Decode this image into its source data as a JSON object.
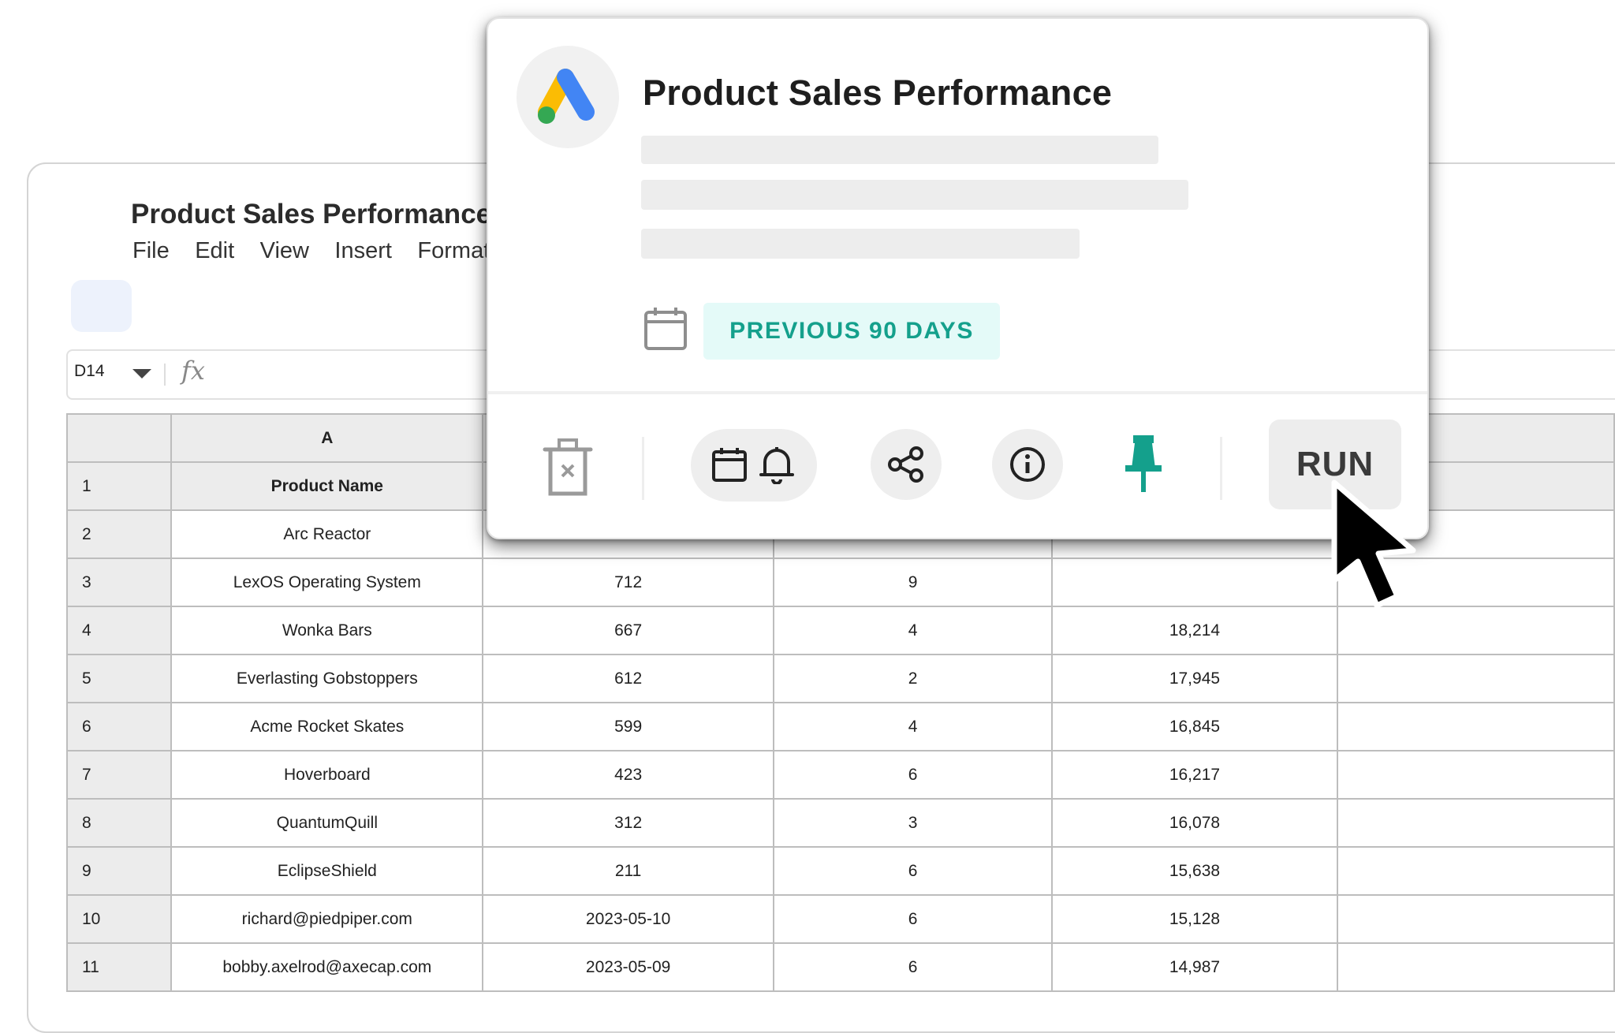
{
  "spreadsheet": {
    "title": "Product Sales Performance",
    "menu": [
      "File",
      "Edit",
      "View",
      "Insert",
      "Format"
    ],
    "namebox": "D14",
    "formula_icon": "fx",
    "column_letters": [
      "",
      "A",
      "",
      "",
      "",
      ""
    ],
    "rows": [
      {
        "num": "1",
        "cells": [
          "Product Name",
          "",
          "",
          "",
          ""
        ]
      },
      {
        "num": "2",
        "cells": [
          "Arc Reactor",
          "",
          "",
          "",
          ""
        ]
      },
      {
        "num": "3",
        "cells": [
          "LexOS Operating System",
          "712",
          "9",
          "",
          ""
        ]
      },
      {
        "num": "4",
        "cells": [
          "Wonka Bars",
          "667",
          "4",
          "18,214",
          ""
        ]
      },
      {
        "num": "5",
        "cells": [
          "Everlasting Gobstoppers",
          "612",
          "2",
          "17,945",
          ""
        ]
      },
      {
        "num": "6",
        "cells": [
          "Acme Rocket Skates",
          "599",
          "4",
          "16,845",
          ""
        ]
      },
      {
        "num": "7",
        "cells": [
          "Hoverboard",
          "423",
          "6",
          "16,217",
          ""
        ]
      },
      {
        "num": "8",
        "cells": [
          "QuantumQuill",
          "312",
          "3",
          "16,078",
          ""
        ]
      },
      {
        "num": "9",
        "cells": [
          "EclipseShield",
          "211",
          "6",
          "15,638",
          ""
        ]
      },
      {
        "num": "10",
        "cells": [
          "richard@piedpiper.com",
          "2023-05-10",
          "6",
          "15,128",
          ""
        ]
      },
      {
        "num": "11",
        "cells": [
          "bobby.axelrod@axecap.com",
          "2023-05-09",
          "6",
          "14,987",
          ""
        ]
      }
    ]
  },
  "popup": {
    "logo_icon": "google-ads-logo-icon",
    "title": "Product Sales Performance",
    "date_range_icon": "calendar-icon",
    "date_range": "PREVIOUS 90 DAYS",
    "actions": {
      "delete_icon": "trash-icon",
      "schedule_icons": [
        "calendar-icon",
        "bell-icon"
      ],
      "share_icon": "share-icon",
      "info_icon": "info-icon",
      "pin_icon": "pin-icon",
      "run_label": "RUN"
    },
    "colors": {
      "badge_text": "#14a08c",
      "badge_bg": "#e4faf8",
      "pin": "#14a08c"
    }
  }
}
